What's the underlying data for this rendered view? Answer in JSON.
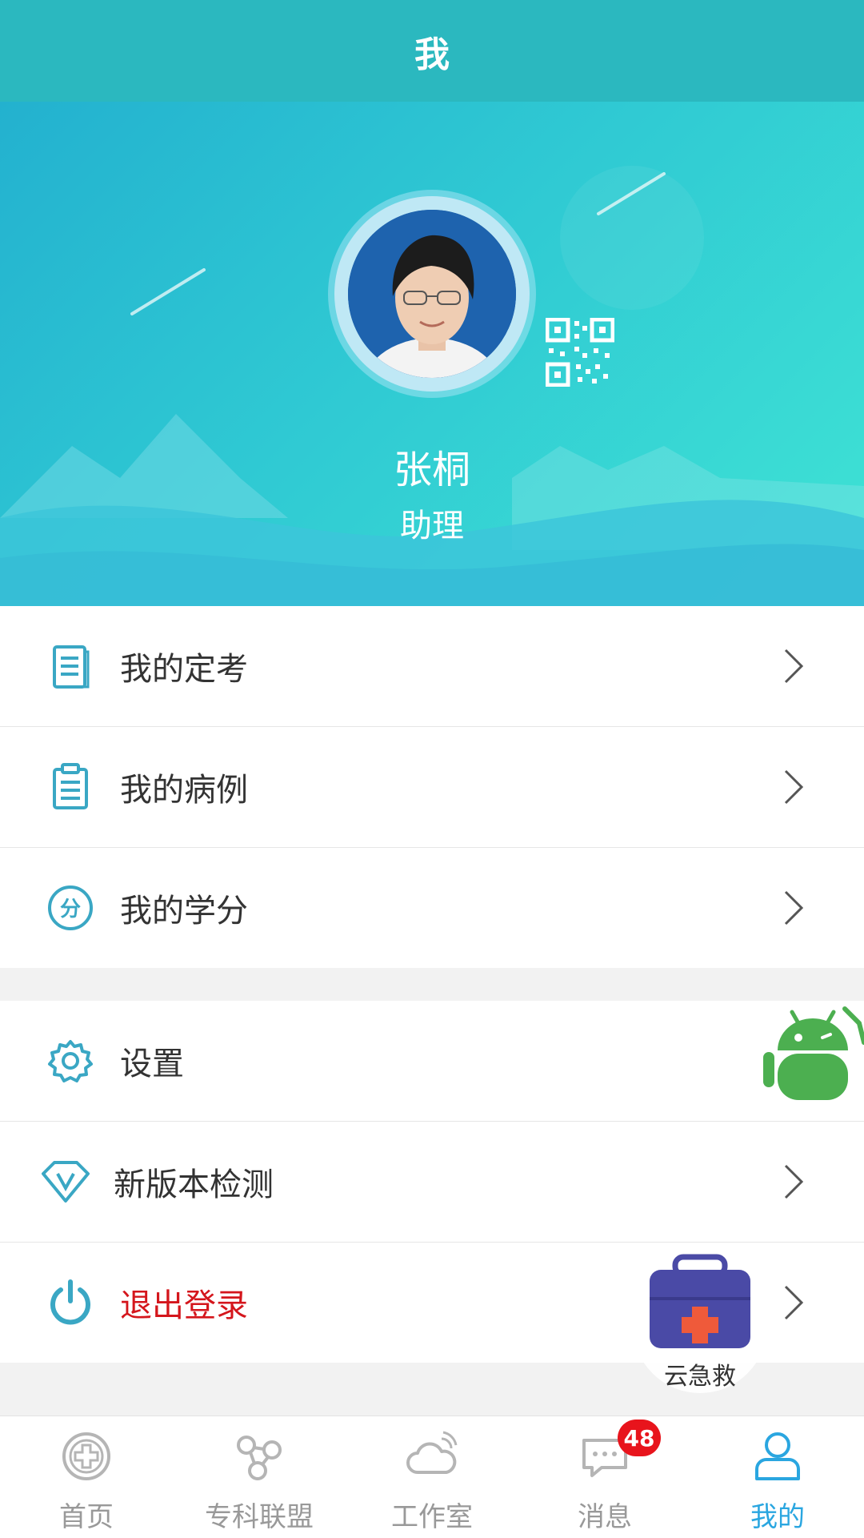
{
  "header": {
    "title": "我"
  },
  "profile": {
    "name": "张桐",
    "role": "助理"
  },
  "menu_primary": [
    {
      "label": "我的定考",
      "icon": "document-icon"
    },
    {
      "label": "我的病例",
      "icon": "clipboard-icon"
    },
    {
      "label": "我的学分",
      "icon": "credit-fen-icon",
      "icon_text": "分"
    }
  ],
  "menu_secondary": [
    {
      "label": "设置",
      "icon": "gear-icon"
    },
    {
      "label": "新版本检测",
      "icon": "version-diamond-icon"
    },
    {
      "label": "退出登录",
      "icon": "power-icon"
    }
  ],
  "floating": {
    "rescue_label": "云急救"
  },
  "tabs": [
    {
      "label": "首页",
      "icon": "home-cross-icon"
    },
    {
      "label": "专科联盟",
      "icon": "alliance-nodes-icon"
    },
    {
      "label": "工作室",
      "icon": "cloud-studio-icon"
    },
    {
      "label": "消息",
      "icon": "message-icon",
      "badge": "48"
    },
    {
      "label": "我的",
      "icon": "user-icon",
      "active": true
    }
  ],
  "colors": {
    "header_bg": "#2bb8bf",
    "accent": "#2aa6e0",
    "icon_teal": "#3aa7c4",
    "danger": "#d4161c",
    "badge": "#e8141c"
  }
}
